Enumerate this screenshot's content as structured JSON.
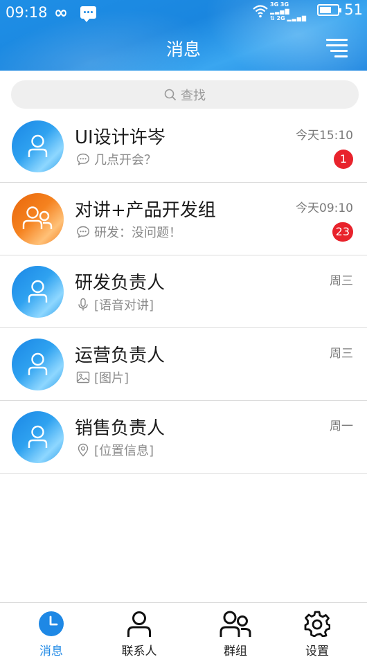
{
  "status_bar": {
    "time": "09:18",
    "signal_text_top": "3G 3G",
    "signal_text_bottom": "2G",
    "battery_level": "51"
  },
  "header": {
    "title": "消息"
  },
  "search": {
    "placeholder": "查找"
  },
  "conversations": [
    {
      "name": "UI设计许岑",
      "time": "今天15:10",
      "preview": "几点开会？",
      "preview_icon": "chat-bubble-icon",
      "badge": "1",
      "avatar_color": "blue",
      "avatar_icon": "person-icon"
    },
    {
      "name": "对讲+产品开发组",
      "time": "今天09:10",
      "preview": "研发：没问题！",
      "preview_icon": "chat-bubble-icon",
      "badge": "23",
      "avatar_color": "orange",
      "avatar_icon": "group-icon"
    },
    {
      "name": "研发负责人",
      "time": "周三",
      "preview": "[语音对讲]",
      "preview_icon": "microphone-icon",
      "badge": "",
      "avatar_color": "blue",
      "avatar_icon": "person-icon"
    },
    {
      "name": "运营负责人",
      "time": "周三",
      "preview": "[图片]",
      "preview_icon": "image-icon",
      "badge": "",
      "avatar_color": "blue",
      "avatar_icon": "person-icon"
    },
    {
      "name": "销售负责人",
      "time": "周一",
      "preview": "[位置信息]",
      "preview_icon": "location-pin-icon",
      "badge": "",
      "avatar_color": "blue",
      "avatar_icon": "person-icon"
    }
  ],
  "bottom_nav": [
    {
      "label": "消息",
      "icon": "clock-icon",
      "active": true
    },
    {
      "label": "联系人",
      "icon": "person-icon",
      "active": false
    },
    {
      "label": "群组",
      "icon": "group-icon",
      "active": false
    },
    {
      "label": "设置",
      "icon": "gear-icon",
      "active": false
    }
  ],
  "colors": {
    "accent": "#1e88e5",
    "badge": "#e8232c",
    "avatar_orange": "#f5821f"
  }
}
